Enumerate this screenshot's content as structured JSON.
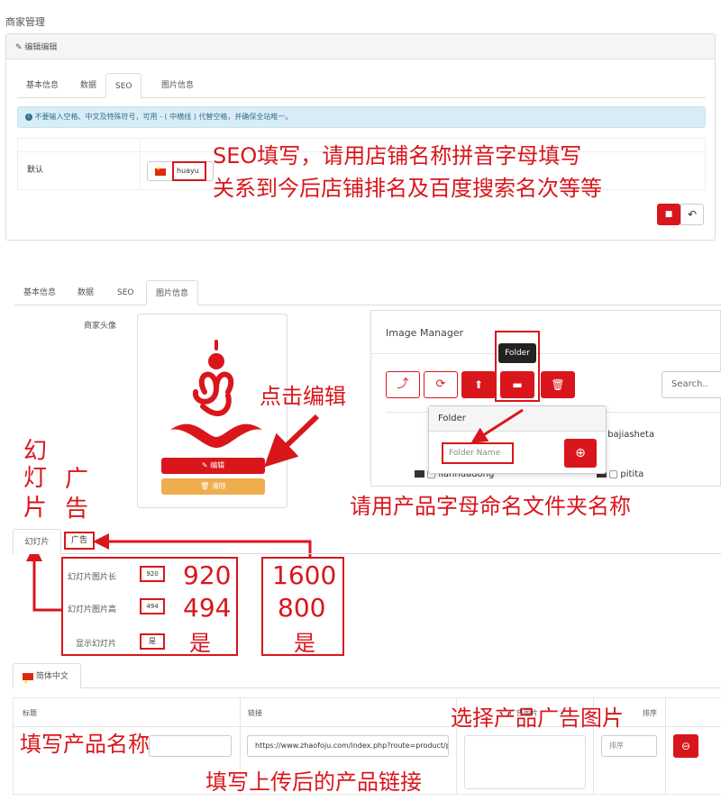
{
  "page_title": "商家管理",
  "edit_panel": {
    "heading": "编辑编辑",
    "tabs": [
      "基本信息",
      "数据",
      "SEO",
      "图片信息"
    ],
    "active_tab": "SEO",
    "alert": "不要输入空格、中文及特殊符号，可用 - ( 中横线 ) 代替空格，并确保全站唯一。",
    "row_label": "默认",
    "seo_value": "huayu"
  },
  "annotations": {
    "seo_line1": "SEO填写，请用店铺名称拼音字母填写",
    "seo_line2": "关系到今后店铺排名及百度搜索名次等等",
    "click_edit": "点击编辑",
    "folder_name_hint": "请用产品字母命名文件夹名称",
    "slideshow_vertical": [
      "幻",
      "灯",
      "片"
    ],
    "ad_vertical": [
      "广",
      "告"
    ],
    "slide_w": "920",
    "slide_h": "494",
    "slide_show": "是",
    "ad_w": "1600",
    "ad_h": "800",
    "ad_show": "是",
    "choose_ad_image": "选择产品广告图片",
    "fill_product_name": "填写产品名称",
    "fill_link": "填写上传后的产品链接"
  },
  "image_panel": {
    "tabs": [
      "基本信息",
      "数据",
      "SEO",
      "图片信息"
    ],
    "active_tab": "图片信息",
    "avatar_label": "商家头像",
    "edit_button": "编辑",
    "clear_button": "清除"
  },
  "image_manager": {
    "title": "Image Manager",
    "tooltip": "Folder",
    "search_placeholder": "Search..",
    "folder_popup_title": "Folder",
    "folder_name_placeholder": "Folder Name",
    "folders": [
      "bajiasheta",
      "lianhuadong",
      "pitita"
    ]
  },
  "slider_section": {
    "tabs": [
      "幻灯片",
      "广告"
    ],
    "active_tab": "幻灯片",
    "fields": [
      {
        "label": "幻灯片图片长",
        "value": "920"
      },
      {
        "label": "幻灯片图片高",
        "value": "494"
      },
      {
        "label": "显示幻灯片",
        "value": "是"
      }
    ],
    "lang_tab": "简体中文",
    "columns": [
      "标题",
      "链接",
      "广告图片",
      "排序"
    ],
    "row": {
      "title": "",
      "link": "https://www.zhaofoju.com/index.php?route=product/pr",
      "sort_placeholder": "排序"
    }
  },
  "colors": {
    "accent": "#d9161c",
    "alert_bg": "#d9edf7",
    "alert_text": "#31708f",
    "warning": "#f0ad4e"
  }
}
